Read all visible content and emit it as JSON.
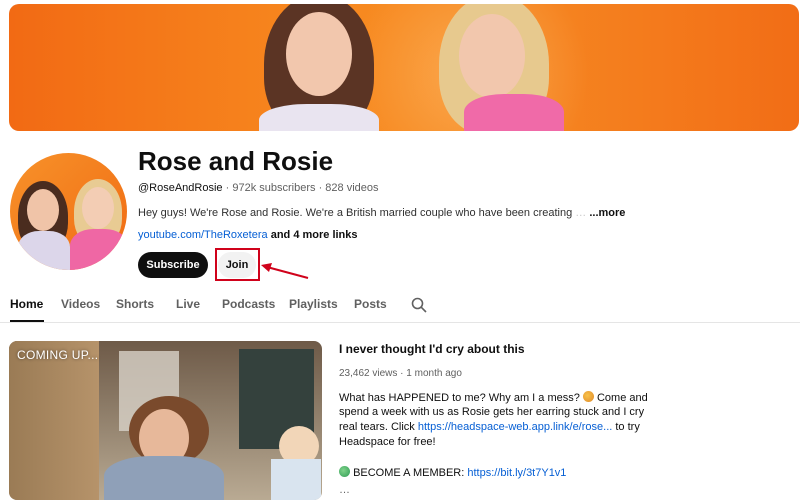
{
  "channel": {
    "name": "Rose and Rosie",
    "handle": "@RoseAndRosie",
    "subscribers": "972k subscribers",
    "videos": "828 videos",
    "separator": "·",
    "description": "Hey guys! We're Rose and Rosie. We're a British married couple who have been creating",
    "description_more": "...more",
    "link": "youtube.com/TheRoxetera",
    "link_extra": "and 4 more links"
  },
  "actions": {
    "subscribe_label": "Subscribe",
    "join_label": "Join"
  },
  "tabs": [
    {
      "label": "Home",
      "active": true
    },
    {
      "label": "Videos"
    },
    {
      "label": "Shorts"
    },
    {
      "label": "Live"
    },
    {
      "label": "Podcasts"
    },
    {
      "label": "Playlists"
    },
    {
      "label": "Posts"
    }
  ],
  "featured_video": {
    "thumbnail_text": "COMING UP...",
    "title": "I never thought I'd cry about this",
    "views": "23,462 views",
    "age": "1 month ago",
    "desc_line1": "What has HAPPENED to me? Why am I a mess?",
    "desc_line1_end": "Come and",
    "desc_line2": "spend a week with us as Rosie gets her earring stuck and I cry",
    "desc_line3_pre": "real tears. Click",
    "desc_line3_link": "https://headspace-web.app.link/e/rose...",
    "desc_line3_post": "to try",
    "desc_line4": "Headspace for free!",
    "member_label": "BECOME A MEMBER:",
    "member_link": "https://bit.ly/3t7Y1v1"
  },
  "colors": {
    "accent_link": "#065fd4",
    "highlight_box": "#d0021b",
    "banner_orange": "#f68a23"
  },
  "icons": {
    "search": "search-icon",
    "arrow": "red-arrow-annotation",
    "member_emoji": "globe-emoji-icon",
    "mess_emoji": "face-emoji-icon"
  }
}
